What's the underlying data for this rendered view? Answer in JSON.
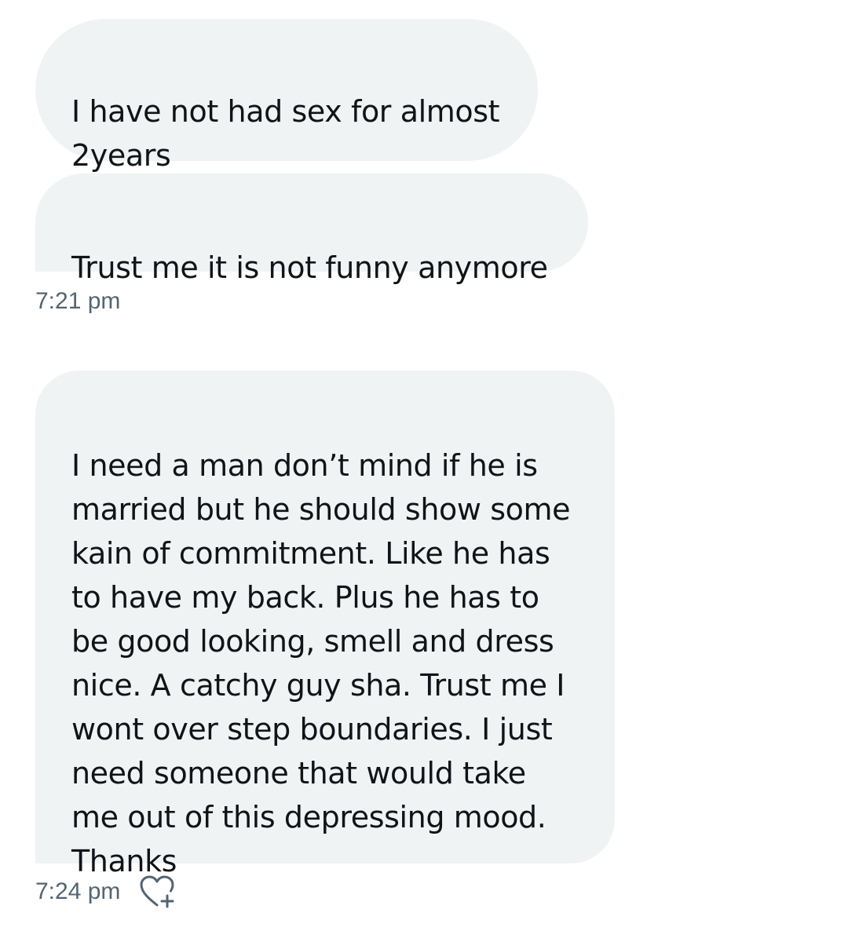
{
  "messages": [
    {
      "text": "I have not had sex for almost\n2years"
    },
    {
      "text": "Trust me it is not funny anymore"
    },
    {
      "text": "I need a man don’t mind if he is\nmarried but he should show some\nkain of commitment. Like he has\nto have my back. Plus he has to\nbe good looking, smell and dress\nnice. A catchy guy sha. Trust me I\nwont over step boundaries. I just\nneed someone that would take\nme out of this depressing mood.\nThanks"
    }
  ],
  "timestamps": [
    "7:21 pm",
    "7:24 pm"
  ],
  "icons": {
    "react": "heart-plus-icon"
  },
  "colors": {
    "bubble_bg": "#eff3f4",
    "text": "#0f1419",
    "timestamp": "#536471"
  }
}
